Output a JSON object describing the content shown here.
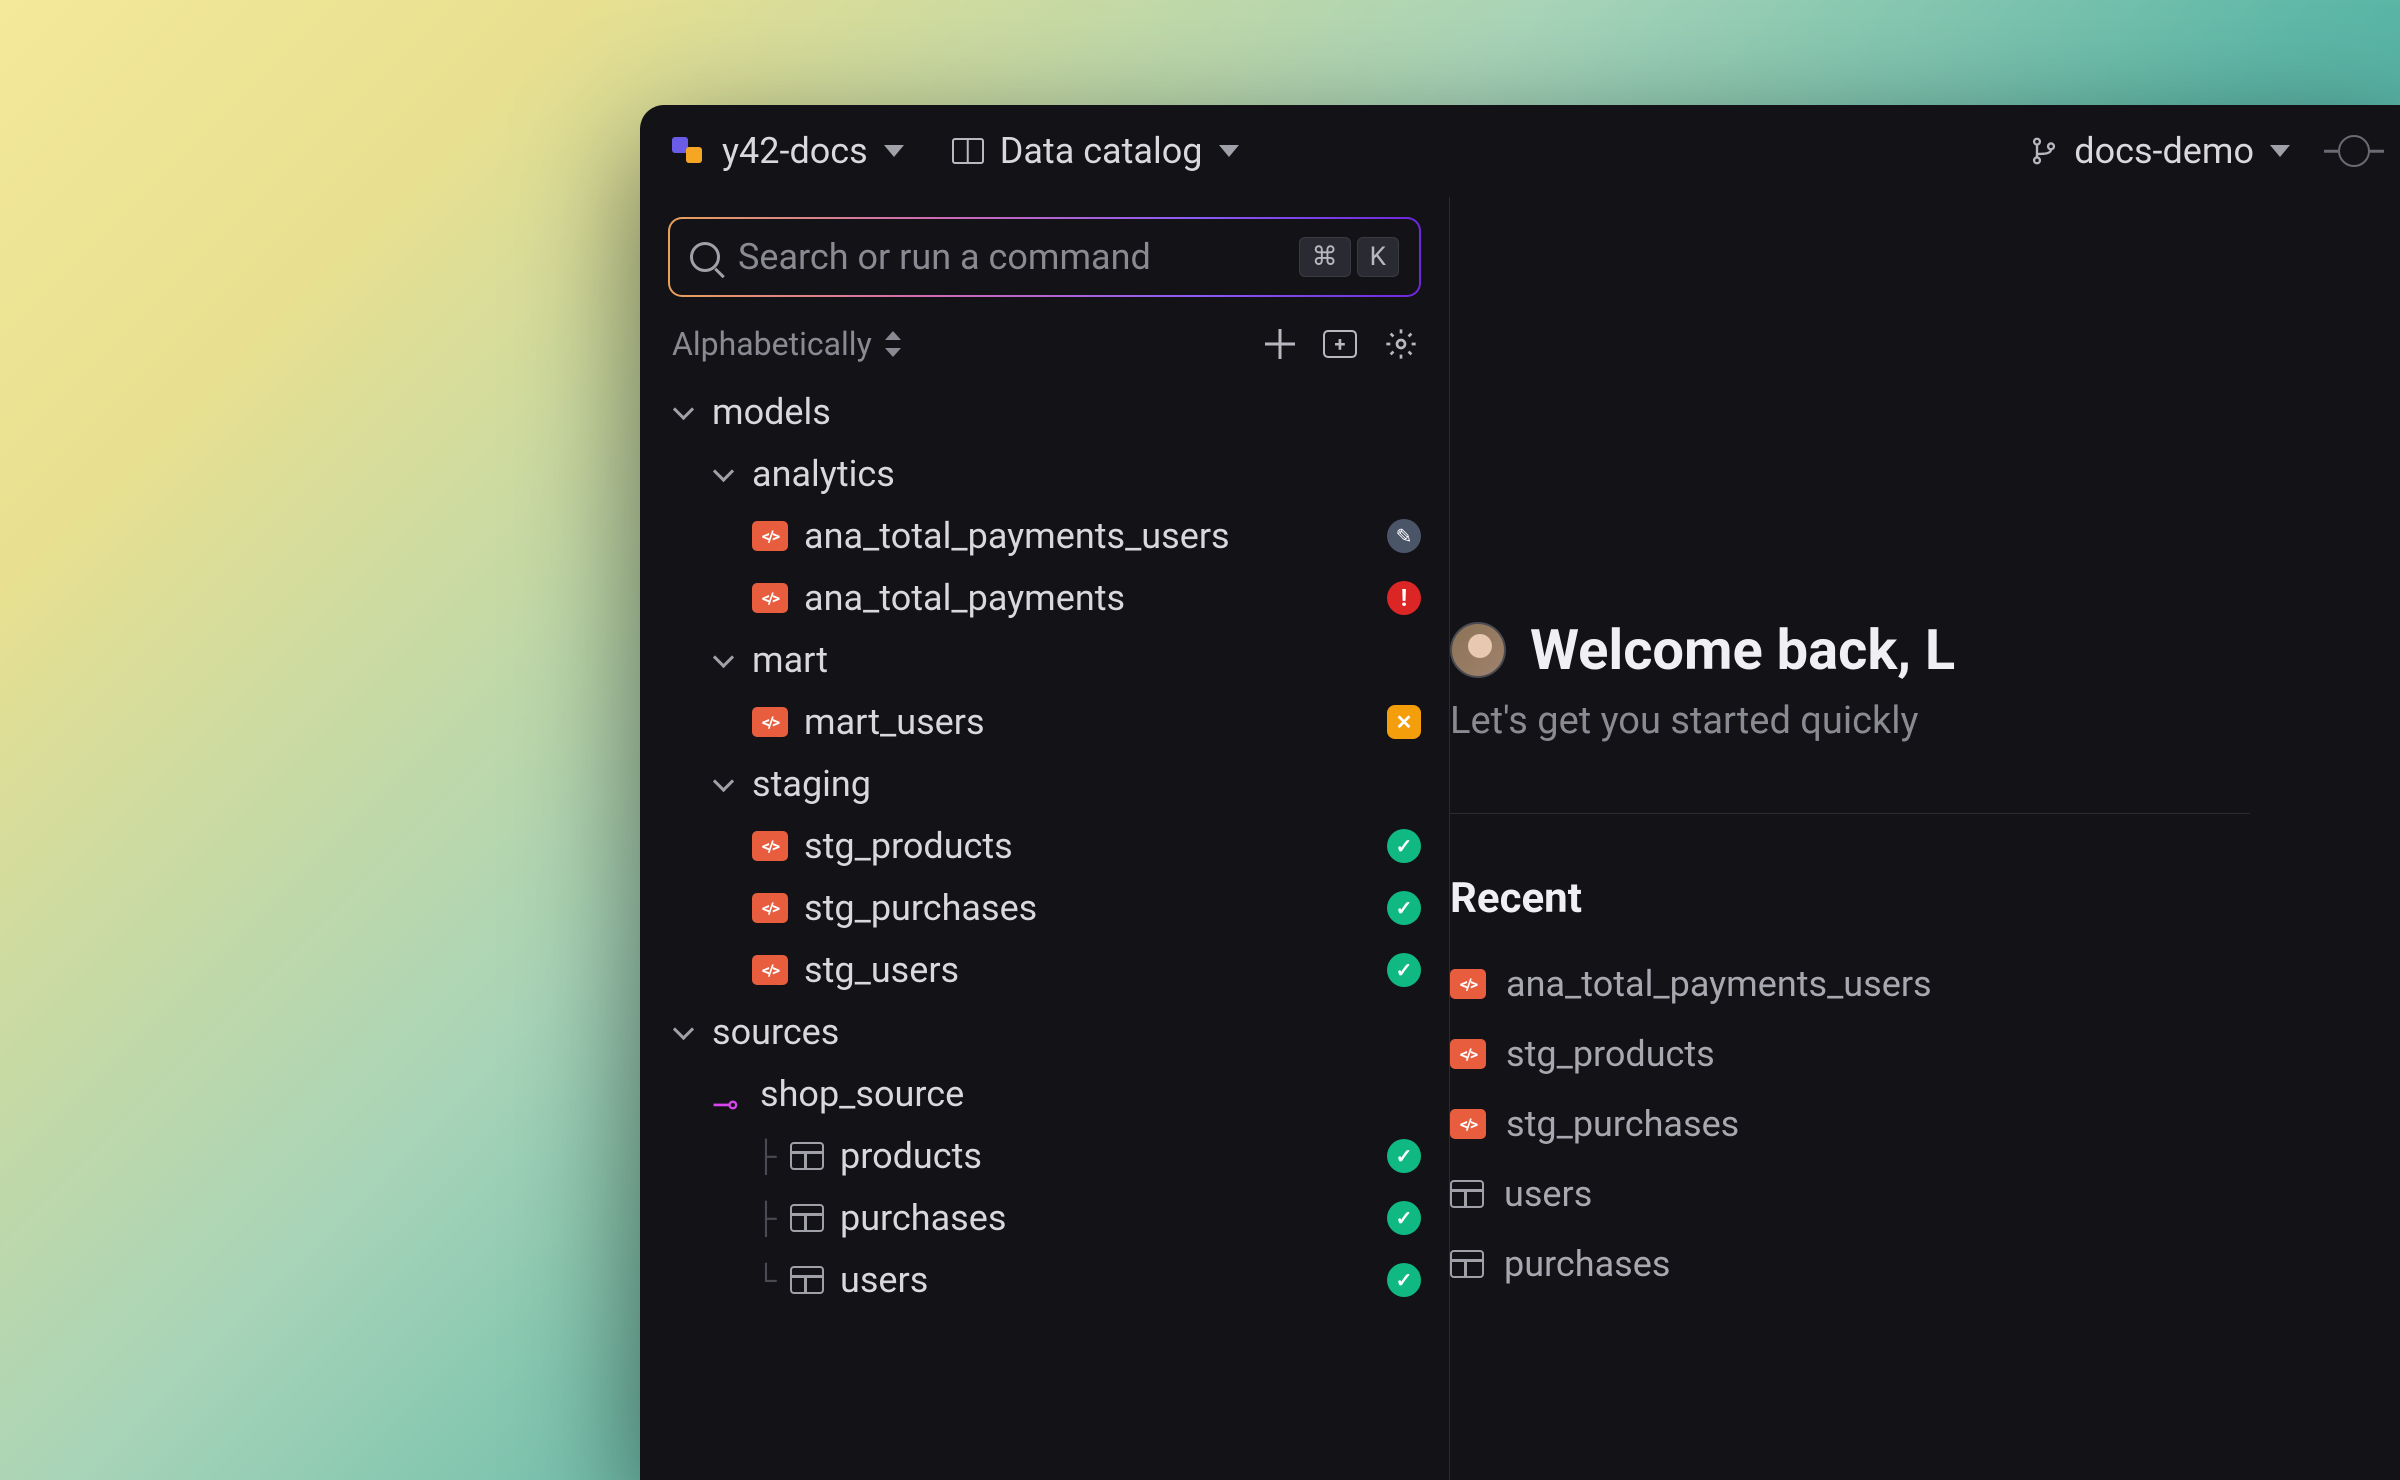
{
  "header": {
    "workspace": "y42-docs",
    "view": "Data catalog",
    "branch": "docs-demo"
  },
  "search": {
    "placeholder": "Search or run a command",
    "shortcut_mod": "⌘",
    "shortcut_key": "K"
  },
  "sort": {
    "label": "Alphabetically"
  },
  "tree": {
    "models_label": "models",
    "analytics_label": "analytics",
    "analytics_items": [
      {
        "name": "ana_total_payments_users",
        "status": "edit"
      },
      {
        "name": "ana_total_payments",
        "status": "error"
      }
    ],
    "mart_label": "mart",
    "mart_items": [
      {
        "name": "mart_users",
        "status": "warn"
      }
    ],
    "staging_label": "staging",
    "staging_items": [
      {
        "name": "stg_products",
        "status": "success"
      },
      {
        "name": "stg_purchases",
        "status": "success"
      },
      {
        "name": "stg_users",
        "status": "success"
      }
    ],
    "sources_label": "sources",
    "shop_source_label": "shop_source",
    "shop_source_items": [
      {
        "name": "products",
        "status": "success"
      },
      {
        "name": "purchases",
        "status": "success"
      },
      {
        "name": "users",
        "status": "success"
      }
    ]
  },
  "welcome": {
    "title": "Welcome back, L",
    "subtitle": "Let's get you started quickly"
  },
  "recent": {
    "title": "Recent",
    "items": [
      {
        "name": "ana_total_payments_users",
        "icon": "model"
      },
      {
        "name": "stg_products",
        "icon": "model"
      },
      {
        "name": "stg_purchases",
        "icon": "model"
      },
      {
        "name": "users",
        "icon": "table"
      },
      {
        "name": "purchases",
        "icon": "table"
      }
    ]
  }
}
